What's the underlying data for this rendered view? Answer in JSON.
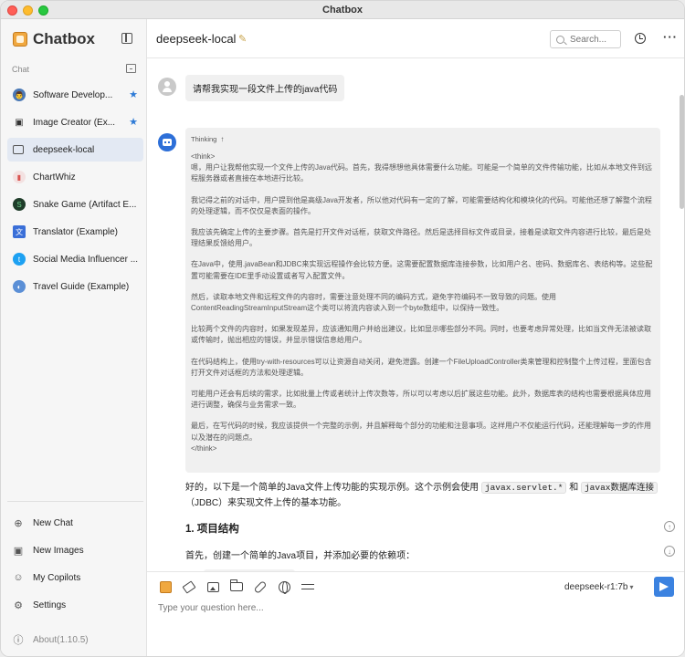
{
  "window": {
    "title": "Chatbox"
  },
  "sidebar": {
    "brand": "Chatbox",
    "section_label": "Chat",
    "conversations": [
      {
        "label": "Software Develop...",
        "icon": "avatar-developer",
        "color": "#4a78b5",
        "starred": true
      },
      {
        "label": "Image Creator (Ex...",
        "icon": "image-icon",
        "color": "#333333",
        "starred": true
      },
      {
        "label": "deepseek-local",
        "icon": "chat-bubble-icon",
        "color": "#555555",
        "starred": false,
        "active": true
      },
      {
        "label": "ChartWhiz",
        "icon": "chart-icon",
        "color": "#d9534f",
        "starred": false
      },
      {
        "label": "Snake Game (Artifact E...",
        "icon": "snake-icon",
        "color": "#2e8b57",
        "starred": false
      },
      {
        "label": "Translator (Example)",
        "icon": "translate-icon",
        "color": "#3a6fd8",
        "starred": false
      },
      {
        "label": "Social Media Influencer ...",
        "icon": "twitter-icon",
        "color": "#1da1f2",
        "starred": false
      },
      {
        "label": "Travel Guide (Example)",
        "icon": "globe-icon",
        "color": "#5b8fd6",
        "starred": false
      }
    ],
    "bottom": [
      {
        "label": "New Chat",
        "icon": "plus-circle-icon"
      },
      {
        "label": "New Images",
        "icon": "image-plus-icon"
      },
      {
        "label": "My Copilots",
        "icon": "robot-icon"
      },
      {
        "label": "Settings",
        "icon": "gear-icon"
      }
    ],
    "about": "About(1.10.5)"
  },
  "header": {
    "title": "deepseek-local",
    "search_placeholder": "Search..."
  },
  "messages": {
    "user_text": "请帮我实现一段文件上传的java代码",
    "thinking_label": "Thinking",
    "thinking_open": "<think>",
    "thinking_paragraphs": [
      "嗯，用户让我帮他实现一个文件上传的Java代码。首先，我得想想他具体需要什么功能。可能是一个简单的文件传输功能，比如从本地文件到远程服务器或者直接在本地进行比较。",
      "我记得之前的对话中，用户提到他是高级Java开发者，所以他对代码有一定的了解，可能需要结构化和模块化的代码。可能他还想了解整个流程的处理逻辑，而不仅仅是表面的操作。",
      "我应该先确定上传的主要步骤。首先是打开文件对话框，获取文件路径。然后是选择目标文件或目录，接着是读取文件内容进行比较，最后是处理结果反馈给用户。",
      "在Java中，使用.javaBean和JDBC来实现远程操作会比较方便。这需要配置数据库连接参数，比如用户名、密码、数据库名、表结构等。这些配置可能需要在IDE里手动设置或者写入配置文件。",
      "然后，读取本地文件和远程文件的内容时，需要注意处理不同的编码方式，避免字符编码不一致导致的问题。使用ContentReadingStreamInputStream这个类可以将流内容读入到一个byte数组中，以保持一致性。",
      "比较两个文件的内容时，如果发现差异，应该通知用户并给出建议，比如显示哪些部分不同。同时，也要考虑异常处理，比如当文件无法被读取或传输时，抛出相应的错误，并显示错误信息给用户。",
      "在代码结构上，使用try-with-resources可以让资源自动关闭，避免泄露。创建一个FileUploadController类来管理和控制整个上传过程，里面包含打开文件对话框的方法和处理逻辑。",
      "可能用户还会有后续的需求，比如批量上传或者统计上传次数等，所以可以考虑以后扩展这些功能。此外，数据库表的结构也需要根据具体应用进行调整，确保与业务需求一致。",
      "最后，在写代码的时候，我应该提供一个完整的示例，并且解释每个部分的功能和注意事项。这样用户不仅能运行代码，还能理解每一步的作用以及潜在的问题点。"
    ],
    "thinking_close": "</think>",
    "answer_intro": "好的，以下是一个简单的Java文件上传功能的实现示例。这个示例会使用",
    "answer_code1": "javax.servlet.*",
    "answer_and": "和",
    "answer_code2": "javax数据库连接",
    "answer_tail": "（JDBC）来实现文件上传的基本功能。",
    "heading_1": "1. 项目结构",
    "para_2": "首先，创建一个简单的Java项目，并添加必要的依赖项："
  },
  "composer": {
    "model": "deepseek-r1:7b",
    "placeholder": "Type your question here..."
  },
  "colors": {
    "accent": "#3b82e0",
    "star": "#2d7ad6"
  }
}
